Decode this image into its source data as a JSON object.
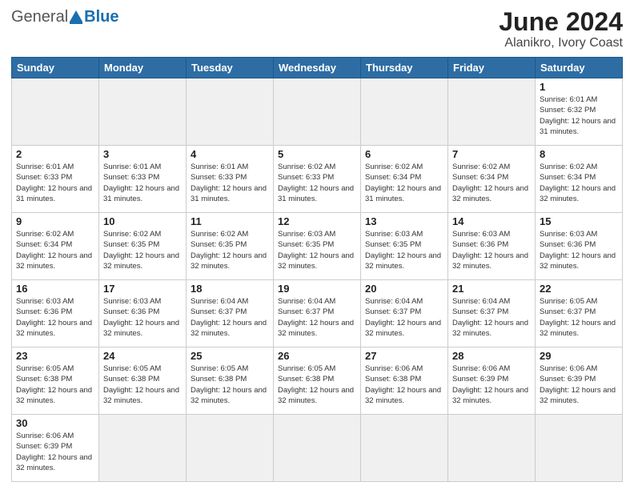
{
  "header": {
    "logo": {
      "general": "General",
      "blue": "Blue"
    },
    "title": "June 2024",
    "location": "Alanikro, Ivory Coast"
  },
  "calendar": {
    "days_of_week": [
      "Sunday",
      "Monday",
      "Tuesday",
      "Wednesday",
      "Thursday",
      "Friday",
      "Saturday"
    ],
    "weeks": [
      [
        {
          "day": null,
          "info": null
        },
        {
          "day": null,
          "info": null
        },
        {
          "day": null,
          "info": null
        },
        {
          "day": null,
          "info": null
        },
        {
          "day": null,
          "info": null
        },
        {
          "day": null,
          "info": null
        },
        {
          "day": "1",
          "info": "Sunrise: 6:01 AM\nSunset: 6:32 PM\nDaylight: 12 hours and 31 minutes."
        }
      ],
      [
        {
          "day": "2",
          "info": "Sunrise: 6:01 AM\nSunset: 6:33 PM\nDaylight: 12 hours and 31 minutes."
        },
        {
          "day": "3",
          "info": "Sunrise: 6:01 AM\nSunset: 6:33 PM\nDaylight: 12 hours and 31 minutes."
        },
        {
          "day": "4",
          "info": "Sunrise: 6:01 AM\nSunset: 6:33 PM\nDaylight: 12 hours and 31 minutes."
        },
        {
          "day": "5",
          "info": "Sunrise: 6:02 AM\nSunset: 6:33 PM\nDaylight: 12 hours and 31 minutes."
        },
        {
          "day": "6",
          "info": "Sunrise: 6:02 AM\nSunset: 6:34 PM\nDaylight: 12 hours and 31 minutes."
        },
        {
          "day": "7",
          "info": "Sunrise: 6:02 AM\nSunset: 6:34 PM\nDaylight: 12 hours and 32 minutes."
        },
        {
          "day": "8",
          "info": "Sunrise: 6:02 AM\nSunset: 6:34 PM\nDaylight: 12 hours and 32 minutes."
        }
      ],
      [
        {
          "day": "9",
          "info": "Sunrise: 6:02 AM\nSunset: 6:34 PM\nDaylight: 12 hours and 32 minutes."
        },
        {
          "day": "10",
          "info": "Sunrise: 6:02 AM\nSunset: 6:35 PM\nDaylight: 12 hours and 32 minutes."
        },
        {
          "day": "11",
          "info": "Sunrise: 6:02 AM\nSunset: 6:35 PM\nDaylight: 12 hours and 32 minutes."
        },
        {
          "day": "12",
          "info": "Sunrise: 6:03 AM\nSunset: 6:35 PM\nDaylight: 12 hours and 32 minutes."
        },
        {
          "day": "13",
          "info": "Sunrise: 6:03 AM\nSunset: 6:35 PM\nDaylight: 12 hours and 32 minutes."
        },
        {
          "day": "14",
          "info": "Sunrise: 6:03 AM\nSunset: 6:36 PM\nDaylight: 12 hours and 32 minutes."
        },
        {
          "day": "15",
          "info": "Sunrise: 6:03 AM\nSunset: 6:36 PM\nDaylight: 12 hours and 32 minutes."
        }
      ],
      [
        {
          "day": "16",
          "info": "Sunrise: 6:03 AM\nSunset: 6:36 PM\nDaylight: 12 hours and 32 minutes."
        },
        {
          "day": "17",
          "info": "Sunrise: 6:03 AM\nSunset: 6:36 PM\nDaylight: 12 hours and 32 minutes."
        },
        {
          "day": "18",
          "info": "Sunrise: 6:04 AM\nSunset: 6:37 PM\nDaylight: 12 hours and 32 minutes."
        },
        {
          "day": "19",
          "info": "Sunrise: 6:04 AM\nSunset: 6:37 PM\nDaylight: 12 hours and 32 minutes."
        },
        {
          "day": "20",
          "info": "Sunrise: 6:04 AM\nSunset: 6:37 PM\nDaylight: 12 hours and 32 minutes."
        },
        {
          "day": "21",
          "info": "Sunrise: 6:04 AM\nSunset: 6:37 PM\nDaylight: 12 hours and 32 minutes."
        },
        {
          "day": "22",
          "info": "Sunrise: 6:05 AM\nSunset: 6:37 PM\nDaylight: 12 hours and 32 minutes."
        }
      ],
      [
        {
          "day": "23",
          "info": "Sunrise: 6:05 AM\nSunset: 6:38 PM\nDaylight: 12 hours and 32 minutes."
        },
        {
          "day": "24",
          "info": "Sunrise: 6:05 AM\nSunset: 6:38 PM\nDaylight: 12 hours and 32 minutes."
        },
        {
          "day": "25",
          "info": "Sunrise: 6:05 AM\nSunset: 6:38 PM\nDaylight: 12 hours and 32 minutes."
        },
        {
          "day": "26",
          "info": "Sunrise: 6:05 AM\nSunset: 6:38 PM\nDaylight: 12 hours and 32 minutes."
        },
        {
          "day": "27",
          "info": "Sunrise: 6:06 AM\nSunset: 6:38 PM\nDaylight: 12 hours and 32 minutes."
        },
        {
          "day": "28",
          "info": "Sunrise: 6:06 AM\nSunset: 6:39 PM\nDaylight: 12 hours and 32 minutes."
        },
        {
          "day": "29",
          "info": "Sunrise: 6:06 AM\nSunset: 6:39 PM\nDaylight: 12 hours and 32 minutes."
        }
      ],
      [
        {
          "day": "30",
          "info": "Sunrise: 6:06 AM\nSunset: 6:39 PM\nDaylight: 12 hours and 32 minutes."
        },
        {
          "day": null,
          "info": null
        },
        {
          "day": null,
          "info": null
        },
        {
          "day": null,
          "info": null
        },
        {
          "day": null,
          "info": null
        },
        {
          "day": null,
          "info": null
        },
        {
          "day": null,
          "info": null
        }
      ]
    ]
  }
}
